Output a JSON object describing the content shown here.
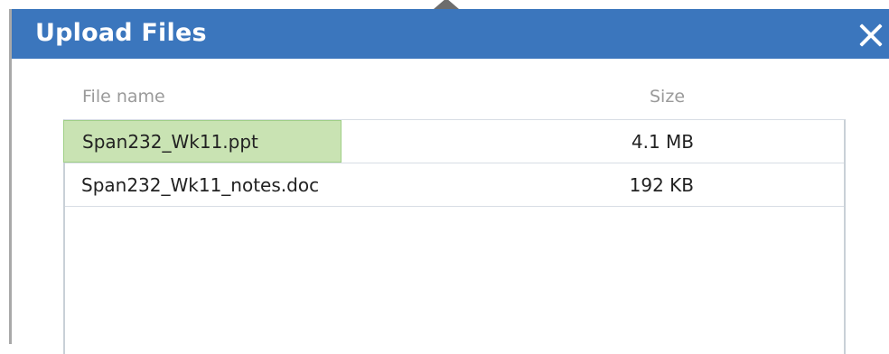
{
  "dialog": {
    "title": "Upload Files",
    "close_icon": "close-icon"
  },
  "table": {
    "headers": {
      "name": "File name",
      "size": "Size"
    },
    "rows": [
      {
        "name": "Span232_Wk11.ppt",
        "size": "4.1 MB",
        "selected": true
      },
      {
        "name": "Span232_Wk11_notes.doc",
        "size": "192 KB",
        "selected": false
      }
    ]
  },
  "colors": {
    "titlebar": "#3b76bd",
    "selection": "#c9e3b3"
  }
}
